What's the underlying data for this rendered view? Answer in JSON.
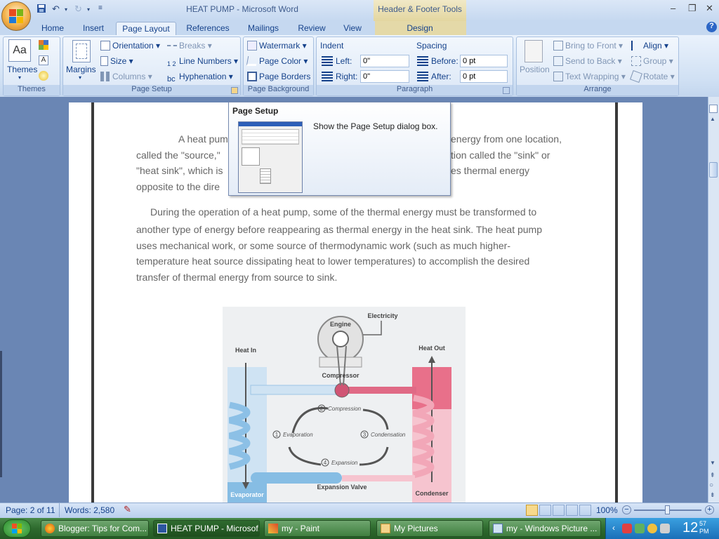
{
  "window": {
    "title": "HEAT PUMP - Microsoft Word",
    "contextual_tab_group": "Header & Footer Tools",
    "minimize": "–",
    "maximize": "❐",
    "close": "✕",
    "help": "?"
  },
  "tabs": [
    "Home",
    "Insert",
    "Page Layout",
    "References",
    "Mailings",
    "Review",
    "View",
    "Design"
  ],
  "ribbon": {
    "themes": {
      "themes_label": "Themes",
      "group_label": "Themes"
    },
    "page_setup": {
      "margins": "Margins",
      "orientation": "Orientation",
      "size": "Size",
      "columns": "Columns",
      "breaks": "Breaks",
      "line_numbers": "Line Numbers",
      "hyphenation": "Hyphenation",
      "group_label": "Page Setup"
    },
    "page_background": {
      "watermark": "Watermark",
      "page_color": "Page Color",
      "page_borders": "Page Borders",
      "group_label": "Page Background"
    },
    "paragraph": {
      "indent": "Indent",
      "left_label": "Left:",
      "left_value": "0\"",
      "right_label": "Right:",
      "right_value": "0\"",
      "spacing": "Spacing",
      "before_label": "Before:",
      "before_value": "0 pt",
      "after_label": "After:",
      "after_value": "0 pt",
      "group_label": "Paragraph"
    },
    "arrange": {
      "position": "Position",
      "bring_to_front": "Bring to Front",
      "send_to_back": "Send to Back",
      "text_wrapping": "Text Wrapping",
      "align": "Align",
      "group": "Group",
      "rotate": "Rotate",
      "group_label": "Arrange"
    }
  },
  "tooltip": {
    "title": "Page Setup",
    "description": "Show the Page Setup dialog box."
  },
  "document": {
    "para1_lines": [
      "A heat pum",
      "energy from one location,",
      "called the \"source,\"",
      "tion called the \"sink\" or",
      "\"heat sink\", which is",
      "es thermal energy",
      "opposite to the dire"
    ],
    "para2_lines": [
      "During the operation of a heat pump, some of the thermal energy must be transformed to",
      "another type of energy before reappearing as thermal energy in the heat sink. The heat pump",
      "uses mechanical work, or some source of thermodynamic work (such as much higher-",
      "temperature heat source dissipating heat to lower temperatures) to accomplish the desired",
      "transfer of thermal energy from source to sink."
    ],
    "diagram": {
      "engine": "Engine",
      "electricity": "Electricity",
      "heat_in": "Heat In",
      "heat_out": "Heat Out",
      "compressor": "Compressor",
      "step1": "Evaporation",
      "step2": "Compression",
      "step3": "Condensation",
      "step4": "Expansion",
      "n1": "1",
      "n2": "2",
      "n3": "3",
      "n4": "4",
      "expansion_valve": "Expansion Valve",
      "evaporator": "Evaporator",
      "condenser": "Condenser"
    }
  },
  "statusbar": {
    "page": "Page: 2 of 11",
    "words": "Words: 2,580",
    "zoom": "100%"
  },
  "taskbar": {
    "items": [
      "Blogger: Tips for Com...",
      "HEAT PUMP - Microsof...",
      "my - Paint",
      "My Pictures",
      "my - Windows Picture ..."
    ],
    "clock_hour": "12",
    "clock_min": "57",
    "clock_ampm": "PM"
  },
  "colors": {
    "accent": "#15428b",
    "ribbon_bg": "#dbe7f6",
    "taskbar": "#2e6a2e",
    "condenser": "#e8708a",
    "evaporator": "#8cc0e6"
  }
}
